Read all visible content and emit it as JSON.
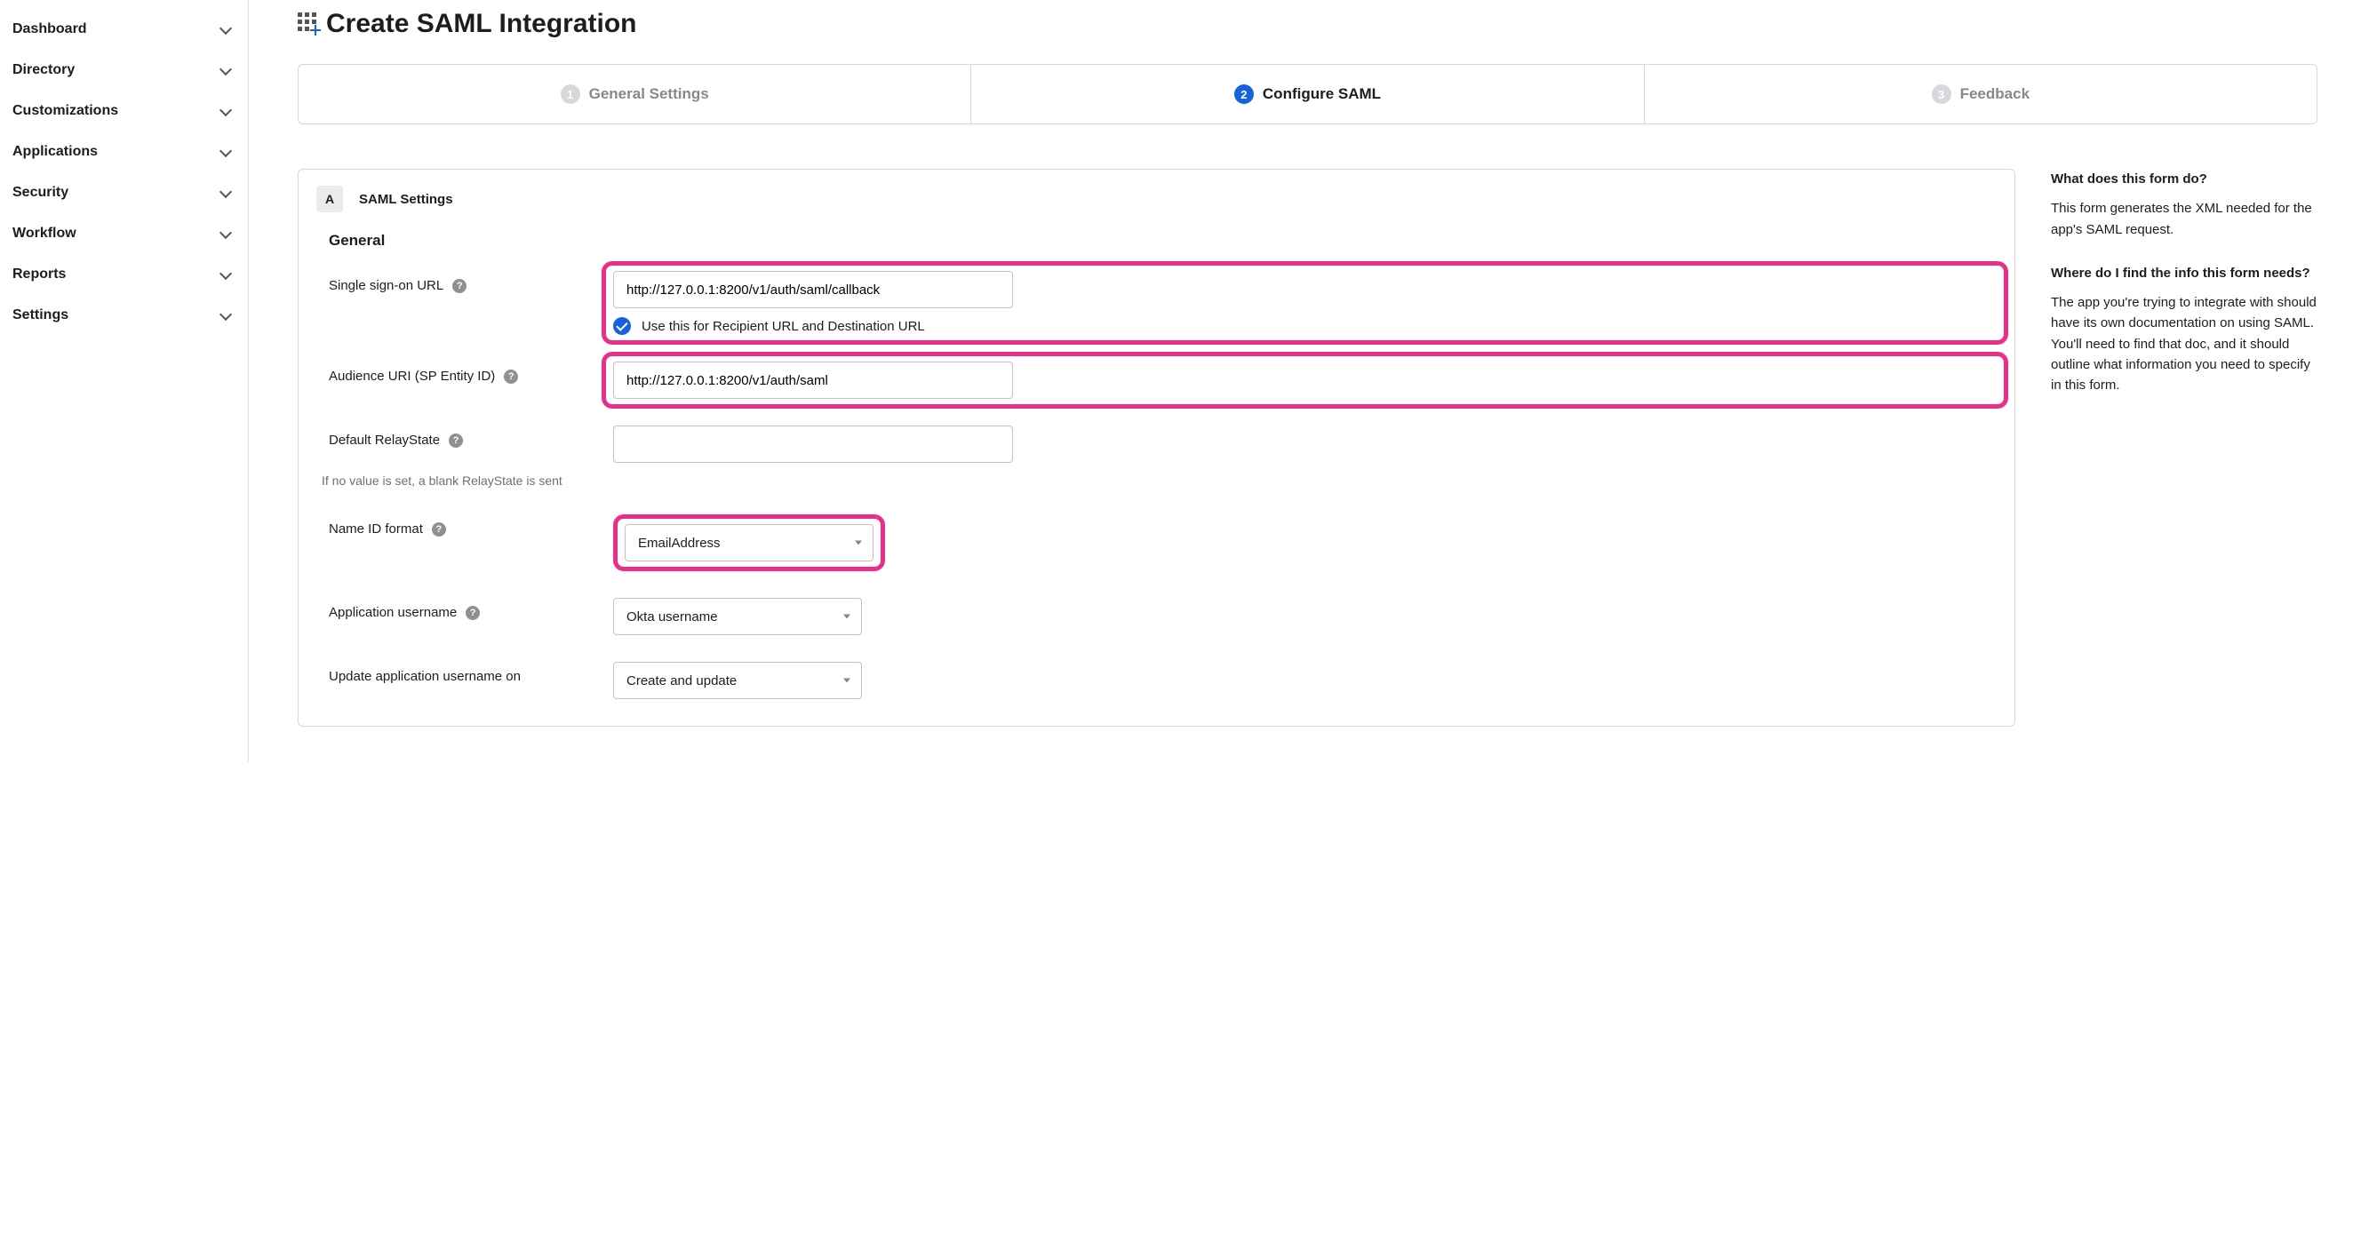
{
  "sidebar": {
    "items": [
      {
        "label": "Dashboard"
      },
      {
        "label": "Directory"
      },
      {
        "label": "Customizations"
      },
      {
        "label": "Applications"
      },
      {
        "label": "Security"
      },
      {
        "label": "Workflow"
      },
      {
        "label": "Reports"
      },
      {
        "label": "Settings"
      }
    ]
  },
  "page": {
    "title": "Create SAML Integration"
  },
  "steps": [
    {
      "num": "1",
      "label": "General Settings",
      "active": false
    },
    {
      "num": "2",
      "label": "Configure SAML",
      "active": true
    },
    {
      "num": "3",
      "label": "Feedback",
      "active": false
    }
  ],
  "panel": {
    "badge": "A",
    "title": "SAML Settings",
    "section": "General"
  },
  "form": {
    "sso_label": "Single sign-on URL",
    "sso_value": "http://127.0.0.1:8200/v1/auth/saml/callback",
    "sso_checkbox_label": "Use this for Recipient URL and Destination URL",
    "audience_label": "Audience URI (SP Entity ID)",
    "audience_value": "http://127.0.0.1:8200/v1/auth/saml",
    "relay_label": "Default RelayState",
    "relay_value": "",
    "relay_note": "If no value is set, a blank RelayState is sent",
    "nameid_label": "Name ID format",
    "nameid_value": "EmailAddress",
    "appuser_label": "Application username",
    "appuser_value": "Okta username",
    "update_label": "Update application username on",
    "update_value": "Create and update"
  },
  "info": {
    "q1": "What does this form do?",
    "a1": "This form generates the XML needed for the app's SAML request.",
    "q2": "Where do I find the info this form needs?",
    "a2": "The app you're trying to integrate with should have its own documentation on using SAML. You'll need to find that doc, and it should outline what information you need to specify in this form."
  }
}
